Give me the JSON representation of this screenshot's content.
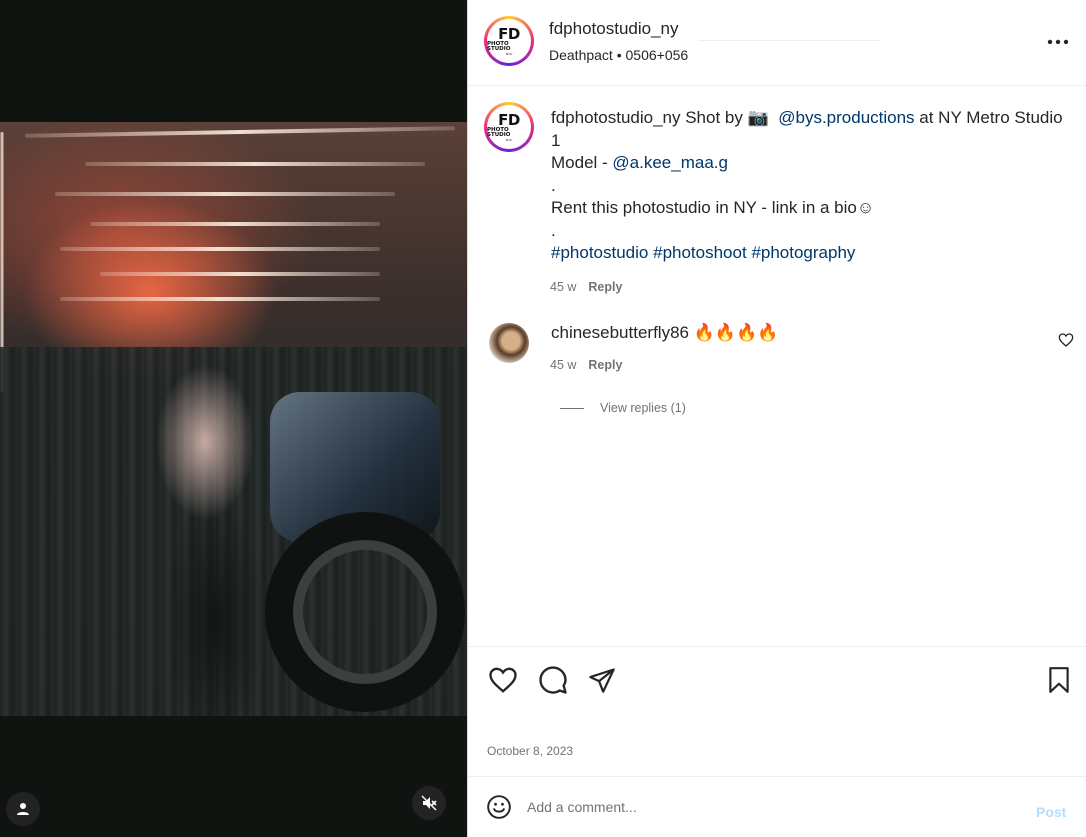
{
  "post": {
    "username": "fdphotostudio_ny",
    "audio": "Deathpact • 0506+056",
    "avatar_logo": {
      "big": "FD",
      "line": "PHOTO STUDIO",
      "small": "NYC"
    }
  },
  "caption": {
    "username": "fdphotostudio_ny",
    "text_1": " Shot by ",
    "camera_emoji": "📷",
    "mention_1": "@bys.productions",
    "text_2": " at NY Metro Studio 1",
    "model_label": "Model - ",
    "mention_2": "@a.kee_maa.g",
    "dot_1": ".",
    "rent_line": "Rent this photostudio in NY - link in a bio☺",
    "dot_2": ".",
    "hashtag_1": "#photostudio",
    "hashtag_2": "#photoshoot",
    "hashtag_3": "#photography",
    "age": "45 w",
    "reply": "Reply"
  },
  "comment": {
    "username": "chinesebutterfly86",
    "text": "🔥🔥🔥🔥",
    "age": "45 w",
    "reply": "Reply",
    "view_replies": "View replies (1)"
  },
  "actions": {
    "date": "October 8, 2023"
  },
  "add_comment": {
    "placeholder": "Add a comment...",
    "post_label": "Post"
  },
  "colors": {
    "link": "#00376b",
    "muted": "#737373",
    "post_disabled": "#b2dffc"
  },
  "icons": {
    "like": "heart-icon",
    "comment": "comment-icon",
    "share": "share-icon",
    "save": "bookmark-icon",
    "more": "more-icon",
    "user_tag": "user-icon",
    "mute": "mute-icon",
    "emoji": "emoji-icon"
  }
}
